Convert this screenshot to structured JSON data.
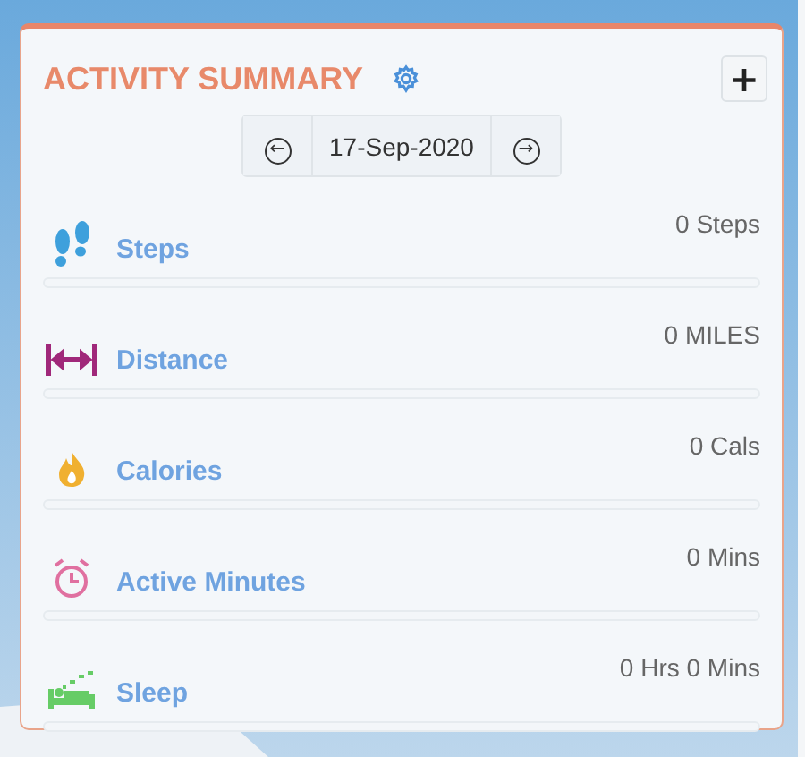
{
  "card": {
    "title": "ACTIVITY SUMMARY",
    "add_button": "+"
  },
  "date_nav": {
    "prev": "←",
    "date": "17-Sep-2020",
    "next": "→"
  },
  "metrics": [
    {
      "kind": "steps",
      "label": "Steps",
      "value": "0 Steps",
      "level": 0
    },
    {
      "kind": "distance",
      "label": "Distance",
      "value": "0 MILES",
      "level": 0
    },
    {
      "kind": "calories",
      "label": "Calories",
      "value": "0 Cals",
      "level": 0
    },
    {
      "kind": "active",
      "label": "Active Minutes",
      "value": "0 Mins",
      "level": 0
    },
    {
      "kind": "sleep",
      "label": "Sleep",
      "value": "0 Hrs 0 Mins",
      "level": 0
    }
  ]
}
